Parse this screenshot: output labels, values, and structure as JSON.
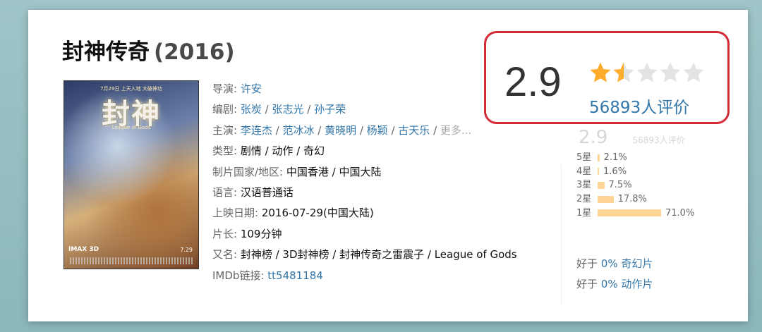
{
  "movie": {
    "title": "封神传奇",
    "year": "(2016)"
  },
  "poster": {
    "top_text": "7月29日 上天入地 大破神功",
    "logo": "封神",
    "sub_text": "League of Gods",
    "imax": "IMAX 3D",
    "date": "7.29"
  },
  "info": {
    "director_label": "导演:",
    "director": "许安",
    "writer_label": "编剧:",
    "writers": [
      "张炭",
      "张志光",
      "孙子荣"
    ],
    "cast_label": "主演:",
    "cast": [
      "李连杰",
      "范冰冰",
      "黄晓明",
      "杨颖",
      "古天乐"
    ],
    "cast_more": "更多...",
    "genre_label": "类型:",
    "genre": "剧情 / 动作 / 奇幻",
    "country_label": "制片国家/地区:",
    "country": "中国香港 / 中国大陆",
    "language_label": "语言:",
    "language": "汉语普通话",
    "release_label": "上映日期:",
    "release": "2016-07-29(中国大陆)",
    "runtime_label": "片长:",
    "runtime": "109分钟",
    "aka_label": "又名:",
    "aka": "封神榜 / 3D封神榜 / 封神传奇之雷震子 / League of Gods",
    "imdb_label": "IMDb链接:",
    "imdb": "tt5481184"
  },
  "rating": {
    "score": "2.9",
    "stars_filled": 1.5,
    "stars_total": 5,
    "votes": "56893人评价",
    "accent_color": "#d42a35",
    "star_color": "#ffac2d"
  },
  "ghost": {
    "score": "2.9",
    "votes": "56893人评价"
  },
  "distribution": [
    {
      "label": "5星",
      "pct": "2.1%",
      "value": 2.1
    },
    {
      "label": "4星",
      "pct": "1.6%",
      "value": 1.6
    },
    {
      "label": "3星",
      "pct": "7.5%",
      "value": 7.5
    },
    {
      "label": "2星",
      "pct": "17.8%",
      "value": 17.8
    },
    {
      "label": "1星",
      "pct": "71.0%",
      "value": 71.0
    }
  ],
  "better_than": [
    {
      "prefix": "好于",
      "value": "0% 奇幻片"
    },
    {
      "prefix": "好于",
      "value": "0% 动作片"
    }
  ]
}
